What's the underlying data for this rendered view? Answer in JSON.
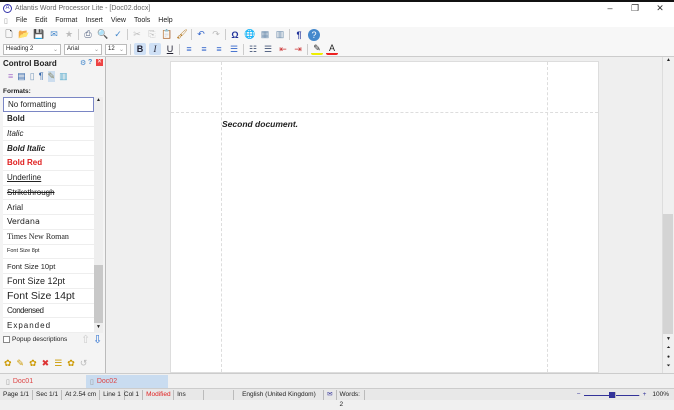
{
  "title": "Atlantis Word Processor Lite - [Doc02.docx]",
  "menu": [
    "File",
    "Edit",
    "Format",
    "Insert",
    "View",
    "Tools",
    "Help"
  ],
  "toolbar": {
    "style": "Heading 2",
    "font": "Arial",
    "size": "12",
    "bold": "B",
    "italic": "I",
    "underline": "U"
  },
  "panel": {
    "title": "Control Board",
    "formats_label": "Formats:",
    "popup_label": "Popup descriptions",
    "formats": [
      "No formatting",
      "Bold",
      "Italic",
      "Bold Italic",
      "Bold Red",
      "Underline",
      "Strikethrough",
      "Arial",
      "Verdana",
      "Times New Roman",
      "Font Size 8pt",
      "Font Size 10pt",
      "Font Size 12pt",
      "Font Size 14pt",
      "Condensed",
      "Expanded"
    ]
  },
  "document": {
    "text": "Second document."
  },
  "tabs": [
    "Doc01",
    "Doc02"
  ],
  "status": {
    "page": "Page 1/1",
    "sec": "Sec 1/1",
    "pos": "At 2.54 cm",
    "line": "Line 1",
    "col": "Col 1",
    "modified": "Modified",
    "mode": "Ins",
    "lang": "English (United Kingdom)",
    "words": "Words: 2",
    "zoom": "100%"
  },
  "colors": {
    "accent": "#1e5bb8",
    "red": "#e02020"
  }
}
